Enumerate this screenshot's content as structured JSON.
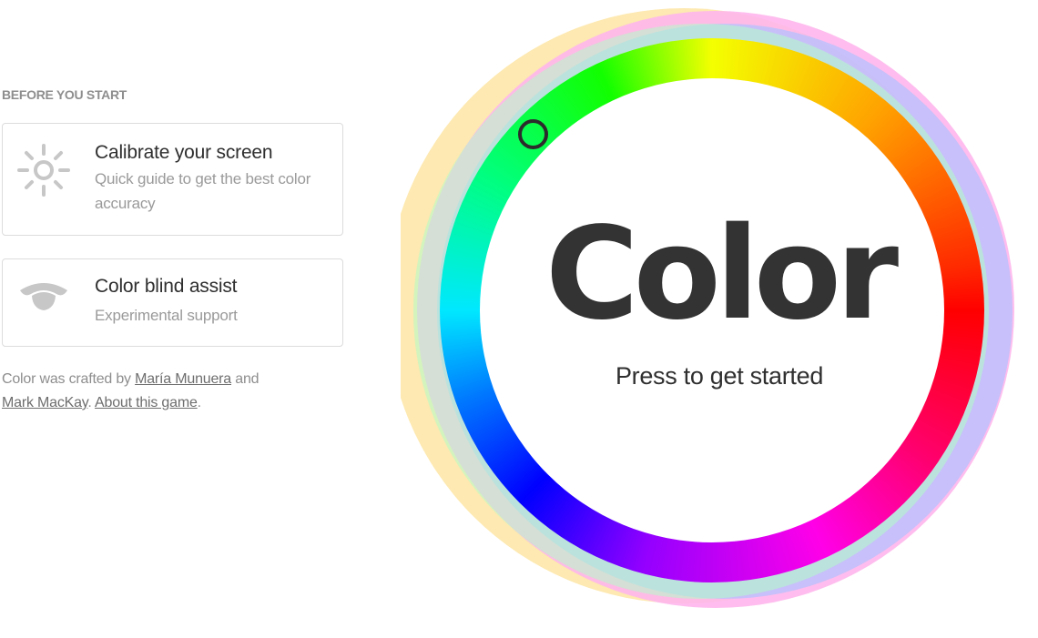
{
  "sidebar": {
    "section_title": "BEFORE YOU START",
    "calibrate": {
      "title": "Calibrate your screen",
      "description": "Quick guide to get the best color accuracy",
      "icon": "sun-icon"
    },
    "colorblind": {
      "title": "Color blind assist",
      "description": "Experimental support",
      "icon": "eye-icon"
    },
    "credits": {
      "prefix": "Color was crafted by ",
      "author1": "María Munuera",
      "joiner": " and ",
      "author2": "Mark MacKay",
      "separator": ". ",
      "about": "About this game",
      "suffix": "."
    }
  },
  "wheel": {
    "title": "Color",
    "subtitle": "Press to get started",
    "colors": {
      "text": "#333333",
      "halo_yellow": "#fde9b1",
      "halo_pink": "#feb6ec",
      "halo_blue": "#b4c2fd",
      "halo_green": "#b2fdc6"
    }
  }
}
